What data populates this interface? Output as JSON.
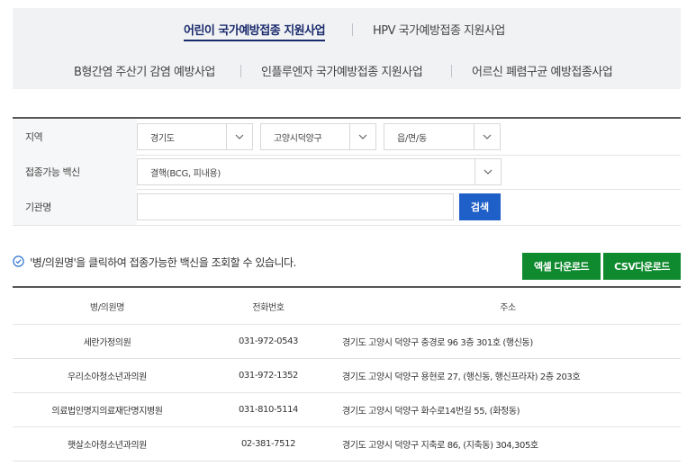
{
  "tabs": {
    "row1": [
      "어린이 국가예방접종 지원사업",
      "HPV 국가예방접종 지원사업"
    ],
    "row2": [
      "B형간염 주산기 감염 예방사업",
      "인플루엔자 국가예방접종 지원사업",
      "어르신 폐렴구균 예방접종사업"
    ]
  },
  "filter": {
    "region_label": "지역",
    "region_values": [
      "경기도",
      "고양시덕양구",
      "읍/면/동"
    ],
    "vaccine_label": "접종가능 백신",
    "vaccine_value": "결핵(BCG, 피내용)",
    "org_label": "기관명",
    "org_value": "",
    "search_label": "검색"
  },
  "info": {
    "text": "'병/의원명'을 클릭하여 접종가능한 백신을 조회할 수 있습니다."
  },
  "actions": {
    "excel": "엑셀 다운로드",
    "csv": "CSV다운로드"
  },
  "table": {
    "headers": [
      "병/의원명",
      "전화번호",
      "주소"
    ],
    "rows": [
      [
        "세란가정의원",
        "031-972-0543",
        "경기도 고양시 덕양구 충경로 96 3층 301호 (행신동)"
      ],
      [
        "우리소아청소년과의원",
        "031-972-1352",
        "경기도 고양시 덕양구 용현로 27, (행신동, 행신프라자) 2층 203호"
      ],
      [
        "의료법인명지의료재단명지병원",
        "031-810-5114",
        "경기도 고양시 덕양구 화수로14번길 55, (화정동)"
      ],
      [
        "햇살소아청소년과의원",
        "02-381-7512",
        "경기도 고양시 덕양구 지축로 86, (지축동) 304,305호"
      ]
    ]
  },
  "colors": {
    "tab_active": "#1a2a6c",
    "search_button": "#1f5fc8",
    "download_button": "#0f8a2e",
    "tab_background": "#f0f2f4"
  }
}
